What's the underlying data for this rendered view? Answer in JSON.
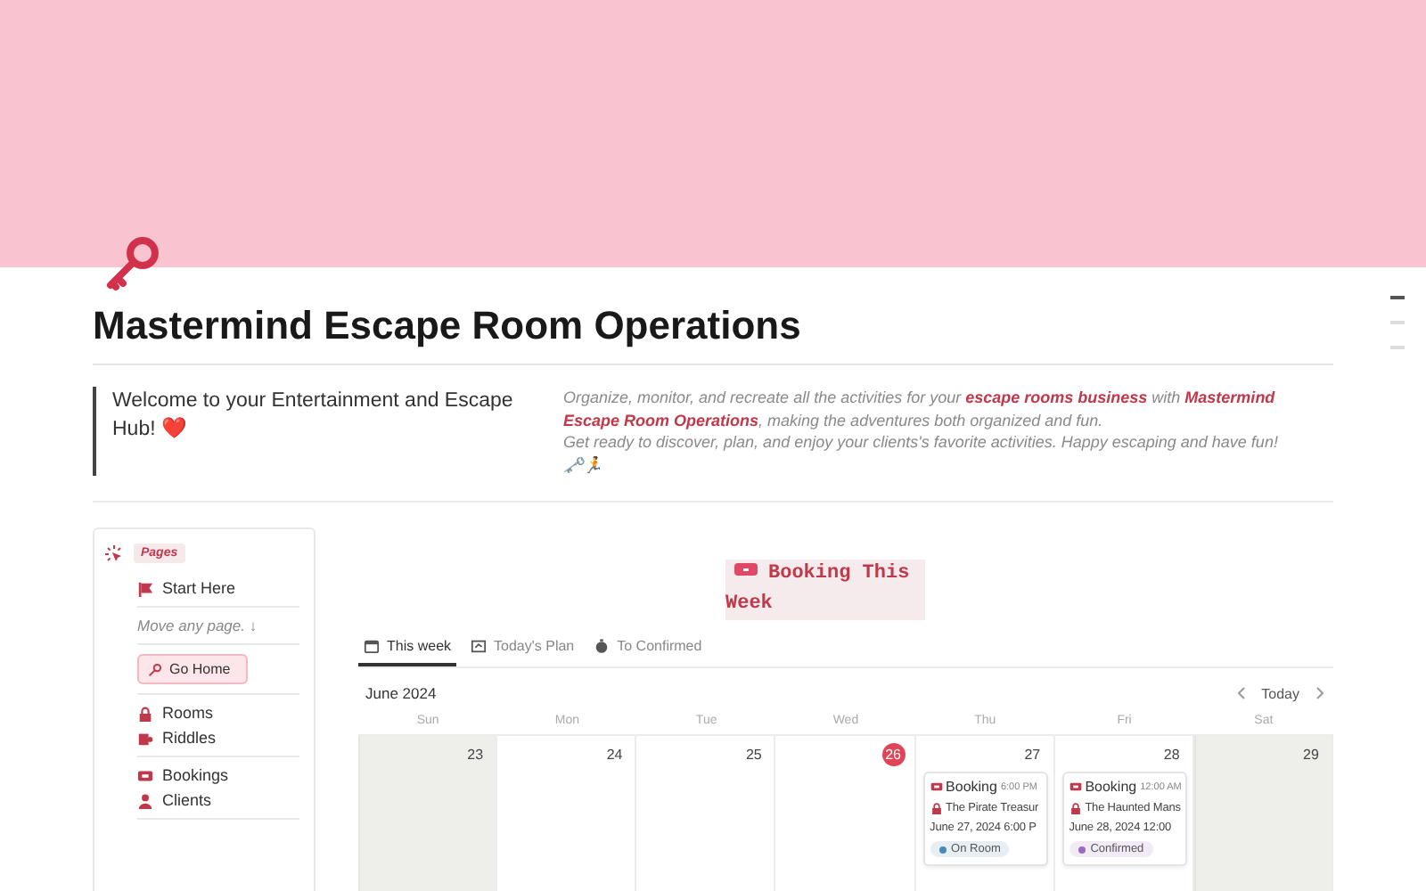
{
  "title": "Mastermind Escape Room Operations",
  "quote": "Welcome to your Entertainment and Escape Hub! ❤️",
  "intro": [
    "Organize, monitor, and recreate all the activities for your **escape rooms business** with **Mastermind Escape Room Operations**, making the adventures both organized and fun.",
    "Get ready to discover, plan, and enjoy your clients's favorite activities. Happy escaping and have fun!",
    "🗝️🏃"
  ],
  "sidebar": {
    "heading": "Pages",
    "groups": [
      {
        "kind": "links",
        "items": [
          {
            "label": "Start Here",
            "kind": "flag"
          }
        ]
      },
      {
        "kind": "note",
        "text": "Move any page. ↓"
      },
      {
        "kind": "button",
        "label": "Go Home"
      },
      {
        "kind": "links",
        "items": [
          {
            "label": "Rooms",
            "kind": "lock"
          },
          {
            "label": "Riddles",
            "kind": "puzzle"
          }
        ]
      },
      {
        "kind": "links",
        "items": [
          {
            "label": "Bookings",
            "kind": "ticket"
          },
          {
            "label": "Clients",
            "kind": "person"
          }
        ]
      }
    ]
  },
  "section_title": "Booking This Week",
  "tabs": [
    {
      "label": "This week",
      "kind": "calendar",
      "selected": true
    },
    {
      "label": "Today's Plan",
      "kind": "board",
      "selected": false
    },
    {
      "label": "To Confirmed",
      "kind": "timer",
      "selected": false
    }
  ],
  "calendar": {
    "month": "June 2024",
    "today_button": "Today",
    "weekdays": [
      "Sun",
      "Mon",
      "Tue",
      "Wed",
      "Thu",
      "Fri",
      "Sat"
    ],
    "days": [
      {
        "day": "23",
        "today": false,
        "weekend": true
      },
      {
        "day": "24",
        "today": false,
        "weekend": false
      },
      {
        "day": "25",
        "today": false,
        "weekend": false
      },
      {
        "day": "26",
        "today": true,
        "weekend": false
      },
      {
        "day": "27",
        "today": false,
        "weekend": false,
        "events": [
          {
            "title": "Booking",
            "time": "6:00 PM",
            "room": "The Pirate Treasur",
            "date": "June 27, 2024 6:00 P",
            "status": "On Room",
            "color": "#4a8ab5"
          }
        ]
      },
      {
        "day": "28",
        "today": false,
        "weekend": false,
        "events": [
          {
            "title": "Booking",
            "time": "12:00 AM",
            "room": "The Haunted Mans",
            "date": "June 28, 2024 12:00",
            "status": "Confirmed",
            "color": "#9a6bbf"
          }
        ]
      },
      {
        "day": "29",
        "today": false,
        "weekend": true
      }
    ]
  }
}
